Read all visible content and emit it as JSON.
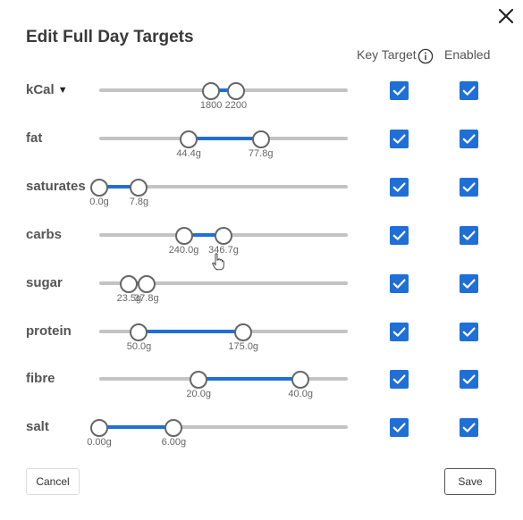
{
  "dialog": {
    "title": "Edit Full Day Targets",
    "header_key_target": "Key Target",
    "header_enabled": "Enabled"
  },
  "colors": {
    "accent": "#1f6fd6",
    "track": "#c3c3c3",
    "thumb_border": "#666666"
  },
  "nutrients": [
    {
      "label": "kCal",
      "has_dropdown": true,
      "min_label": "1800",
      "max_label": "2200",
      "min_fraction": 0.45,
      "max_fraction": 0.55,
      "key_target": true,
      "enabled": true
    },
    {
      "label": "fat",
      "min_label": "44.4g",
      "max_label": "77.8g",
      "min_fraction": 0.36,
      "max_fraction": 0.65,
      "key_target": true,
      "enabled": true
    },
    {
      "label": "saturates",
      "min_label": "0.0g",
      "max_label": "7.8g",
      "min_fraction": 0.0,
      "max_fraction": 0.16,
      "key_target": true,
      "enabled": true
    },
    {
      "label": "carbs",
      "min_label": "240.0g",
      "max_label": "346.7g",
      "min_fraction": 0.34,
      "max_fraction": 0.5,
      "key_target": true,
      "enabled": true
    },
    {
      "label": "sugar",
      "min_label": "23.5g",
      "max_label": "37.8g",
      "min_fraction": 0.12,
      "max_fraction": 0.19,
      "key_target": true,
      "enabled": true
    },
    {
      "label": "protein",
      "min_label": "50.0g",
      "max_label": "175.0g",
      "min_fraction": 0.16,
      "max_fraction": 0.58,
      "key_target": true,
      "enabled": true
    },
    {
      "label": "fibre",
      "min_label": "20.0g",
      "max_label": "40.0g",
      "min_fraction": 0.4,
      "max_fraction": 0.81,
      "key_target": true,
      "enabled": true
    },
    {
      "label": "salt",
      "min_label": "0.00g",
      "max_label": "6.00g",
      "min_fraction": 0.0,
      "max_fraction": 0.3,
      "key_target": true,
      "enabled": true
    }
  ],
  "buttons": {
    "cancel": "Cancel",
    "save": "Save"
  },
  "icons": {
    "close": "close-icon",
    "info": "info-icon",
    "dropdown": "caret-down-icon",
    "check": "check-icon",
    "cursor": "hand-pointer-icon"
  }
}
